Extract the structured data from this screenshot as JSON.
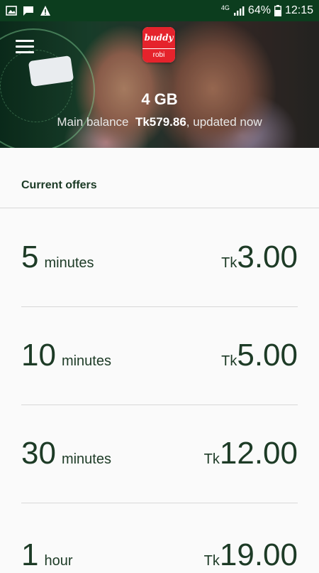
{
  "status_bar": {
    "network": "4G",
    "battery": "64%",
    "time": "12:15"
  },
  "app": {
    "logo_text_top": "buddy",
    "logo_text_bottom": "robi"
  },
  "header": {
    "data_amount": "4 GB",
    "balance_label": "Main balance",
    "balance_value": "Tk579.86",
    "balance_suffix": ", updated now"
  },
  "offers": {
    "title": "Current offers",
    "items": [
      {
        "duration": "5",
        "unit": "minutes",
        "currency": "Tk",
        "price": "3.00"
      },
      {
        "duration": "10",
        "unit": "minutes",
        "currency": "Tk",
        "price": "5.00"
      },
      {
        "duration": "30",
        "unit": "minutes",
        "currency": "Tk",
        "price": "12.00"
      },
      {
        "duration": "1",
        "unit": "hour",
        "currency": "Tk",
        "price": "19.00"
      }
    ]
  },
  "colors": {
    "status_bar": "#0c3d1e",
    "text_dark_green": "#1d3b26",
    "brand_red": "#e5232c"
  },
  "icons": [
    "image-icon",
    "message-icon",
    "alert-icon",
    "signal-icon",
    "battery-icon",
    "menu-icon"
  ]
}
